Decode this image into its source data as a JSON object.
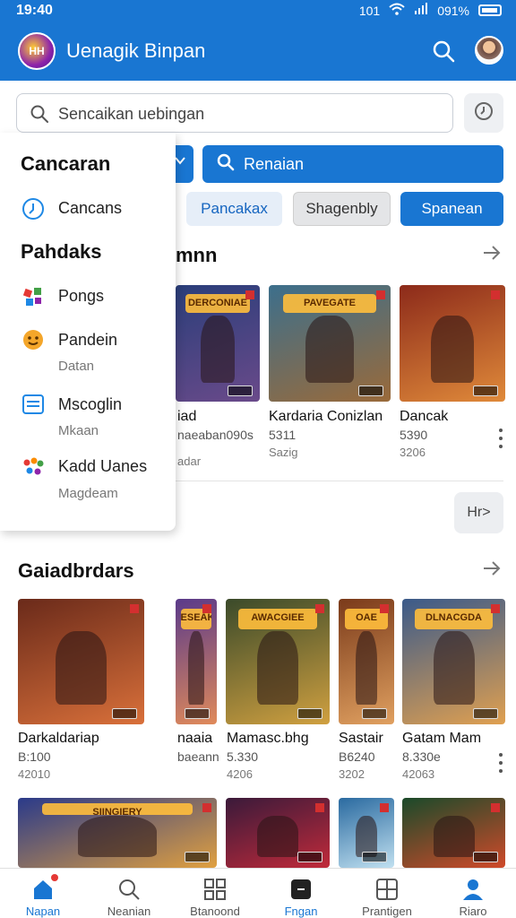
{
  "status_bar": {
    "time": "19:40",
    "indicators": "101",
    "battery": "091%"
  },
  "app_bar": {
    "logo_text": "HH",
    "title": "Uenagik Binpan"
  },
  "search": {
    "placeholder": "Sencaikan uebingan"
  },
  "filters": {
    "search_button": "Renaian",
    "chips": [
      "Pancakax",
      "Shagenbly",
      "Spanean"
    ]
  },
  "drawer": {
    "heading1": "Cancaran",
    "item1": "Cancans",
    "heading2": "Pahdaks",
    "items": [
      {
        "label": "Pongs",
        "sub": ""
      },
      {
        "label": "Pandein",
        "sub": "Datan"
      },
      {
        "label": "Mscoglin",
        "sub": "Mkaan"
      },
      {
        "label": "Kadd Uanes",
        "sub": "Magdeam"
      }
    ]
  },
  "section1": {
    "title_partial": "mnn",
    "cards": [
      {
        "name": "iad",
        "price": "naeaban090s",
        "sub": "adar",
        "banner": "DERCONIAE",
        "colors": [
          "#2a3e7a",
          "#6a4a8a"
        ]
      },
      {
        "name": "Kardaria Conizlan",
        "price": "5311",
        "sub": "Sazig",
        "banner": "PAVEGATE",
        "colors": [
          "#3c6f8c",
          "#9a6a3a"
        ]
      },
      {
        "name": "Dancak",
        "price": "5390",
        "sub": "3206",
        "banner": "",
        "colors": [
          "#8c2a1a",
          "#e08a3a"
        ]
      }
    ],
    "more_label": "Hr>"
  },
  "section2": {
    "title": "Gaiadbrdars",
    "cards": [
      {
        "name": "Darkaldariap",
        "price": "B:100",
        "sub": "42010",
        "banner": "",
        "colors": [
          "#6a2a1a",
          "#d9703a"
        ]
      },
      {
        "name": "naaia",
        "price": "baeann",
        "sub": "",
        "banner": "ESEAKE",
        "colors": [
          "#5a3a8a",
          "#e08a5a"
        ]
      },
      {
        "name": "Mamasc.bhg",
        "price": "5.330",
        "sub": "4206",
        "banner": "AWACGIEE",
        "colors": [
          "#3a4a2a",
          "#d0a040"
        ]
      },
      {
        "name": "Sastair",
        "price": "B6240",
        "sub": "3202",
        "banner": "OAE",
        "colors": [
          "#7a3a1a",
          "#e0a060"
        ]
      },
      {
        "name": "Gatam Mam",
        "price": "8.330e",
        "sub": "42063",
        "banner": "DLNACGDA",
        "colors": [
          "#3a5a8a",
          "#e0a050"
        ]
      }
    ],
    "bottom_cards": [
      {
        "banner": "SIINGIERY",
        "colors": [
          "#2a3a8a",
          "#e0a040"
        ]
      },
      {
        "banner": "",
        "colors": [
          "#3a1a3a",
          "#c02a3a"
        ]
      },
      {
        "banner": "",
        "colors": [
          "#2a6aa0",
          "#c0e0f0"
        ]
      },
      {
        "banner": "",
        "colors": [
          "#1a4a2a",
          "#d04a2a"
        ]
      }
    ]
  },
  "bottom_nav": [
    "Napan",
    "Neanian",
    "Btanoond",
    "Fngan",
    "Prantigen",
    "Riaro"
  ],
  "colors": {
    "primary": "#1976d2",
    "chip_light": "#e6eef8"
  }
}
